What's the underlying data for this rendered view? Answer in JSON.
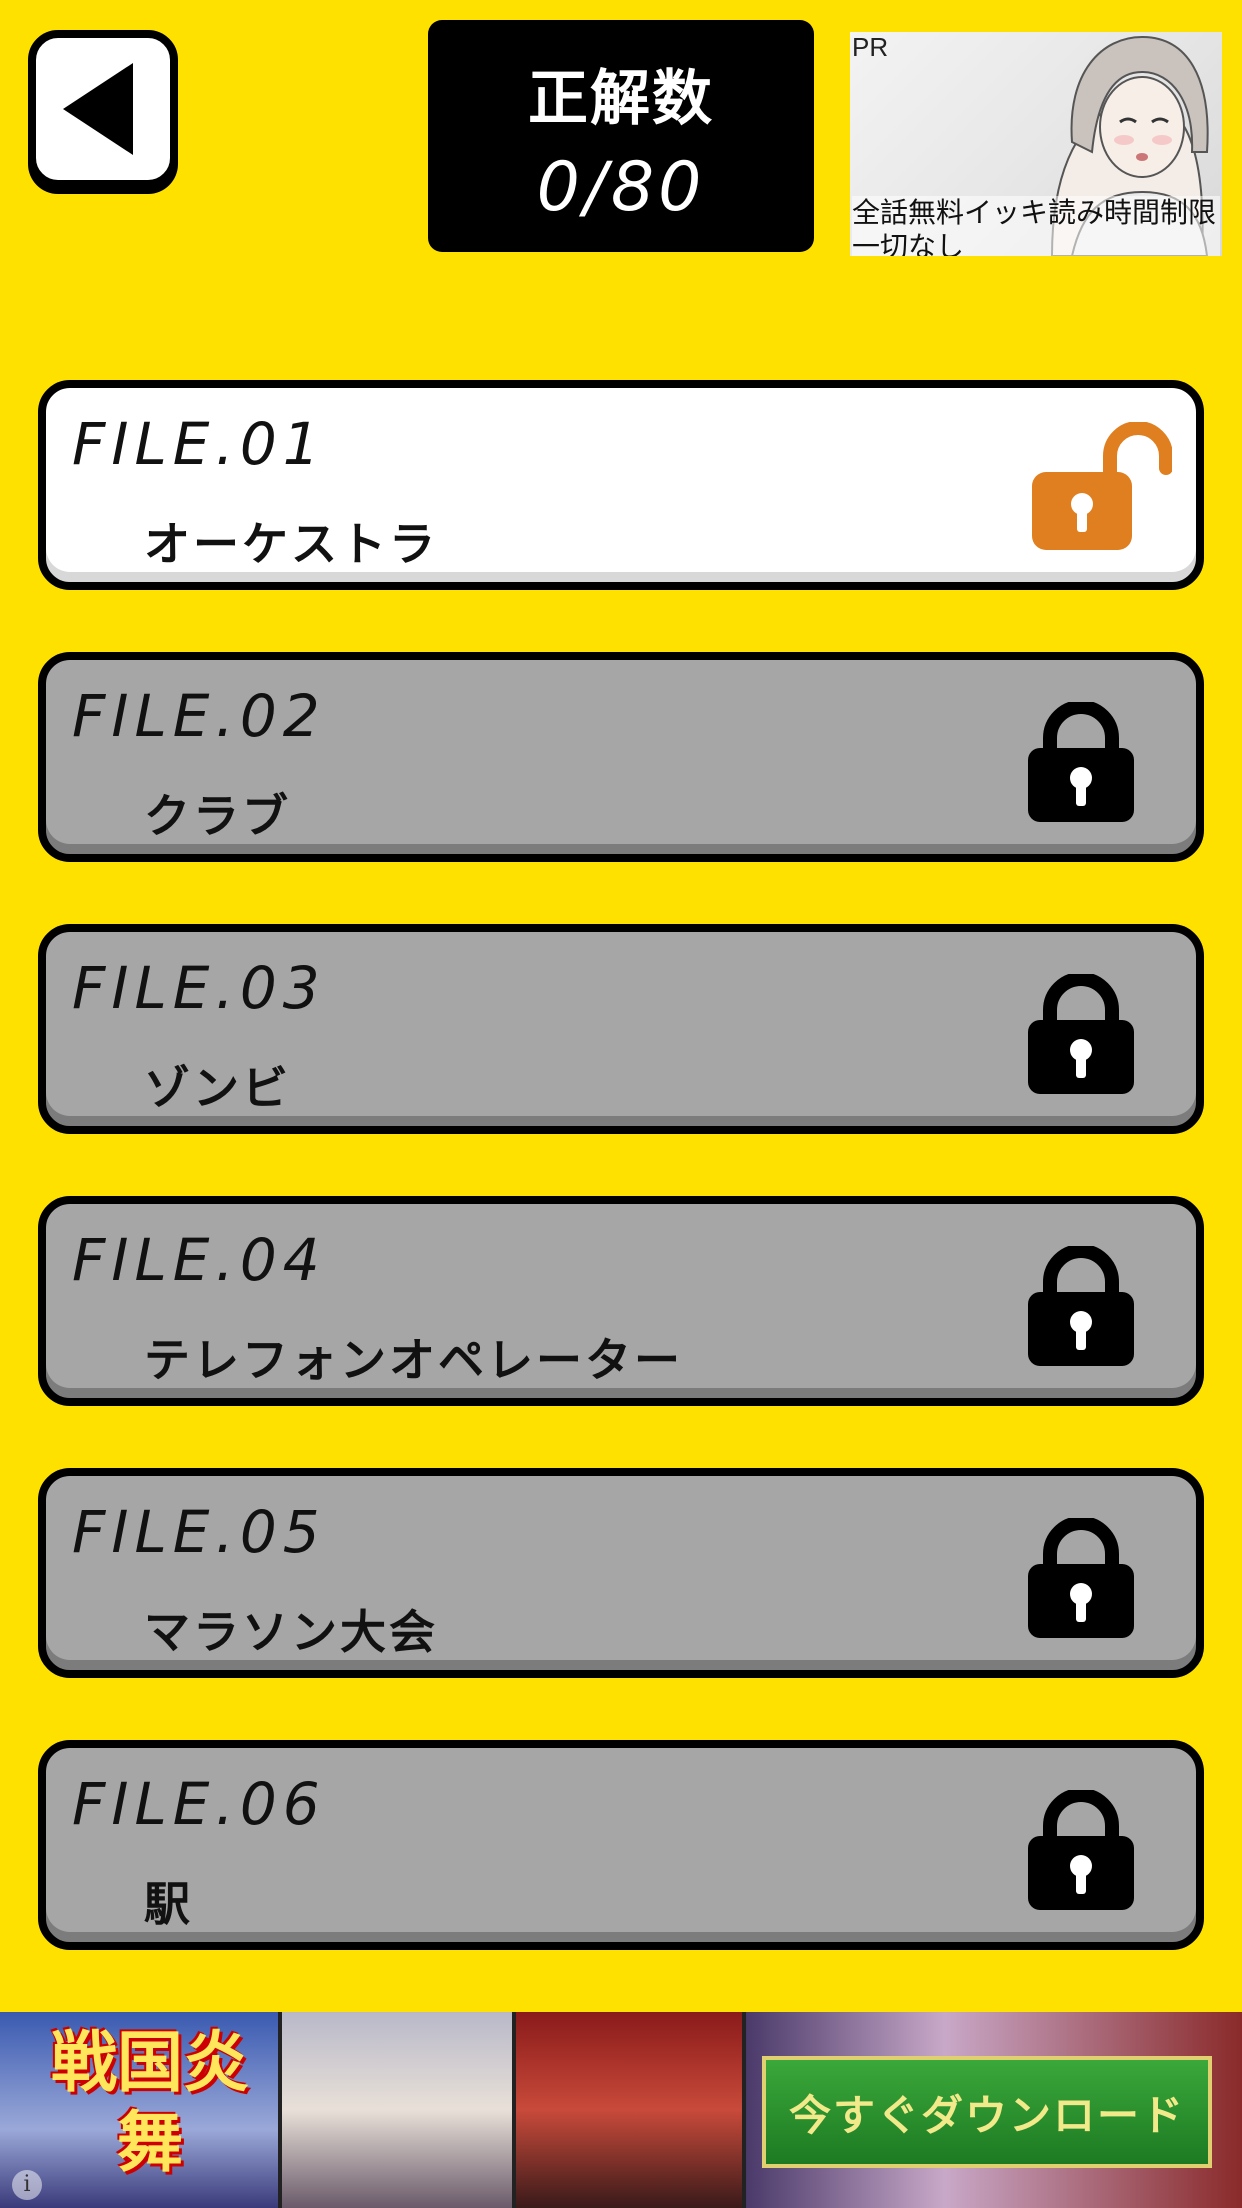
{
  "header": {
    "score_title": "正解数",
    "score_value": "0/80"
  },
  "top_ad": {
    "pr_label": "PR",
    "text": "全話無料イッキ読み時間制限一切なし"
  },
  "files": [
    {
      "num": "FILE.01",
      "name": "オーケストラ",
      "locked": false
    },
    {
      "num": "FILE.02",
      "name": "クラブ",
      "locked": true
    },
    {
      "num": "FILE.03",
      "name": "ゾンビ",
      "locked": true
    },
    {
      "num": "FILE.04",
      "name": "テレフォンオペレーター",
      "locked": true
    },
    {
      "num": "FILE.05",
      "name": "マラソン大会",
      "locked": true
    },
    {
      "num": "FILE.06",
      "name": "駅",
      "locked": true
    }
  ],
  "bottom_ad": {
    "logo_text": "戦国炎舞",
    "download_label": "今すぐダウンロード"
  },
  "colors": {
    "background": "#ffe100",
    "unlocked_icon": "#e07f1f",
    "locked_card": "#a6a6a6"
  }
}
